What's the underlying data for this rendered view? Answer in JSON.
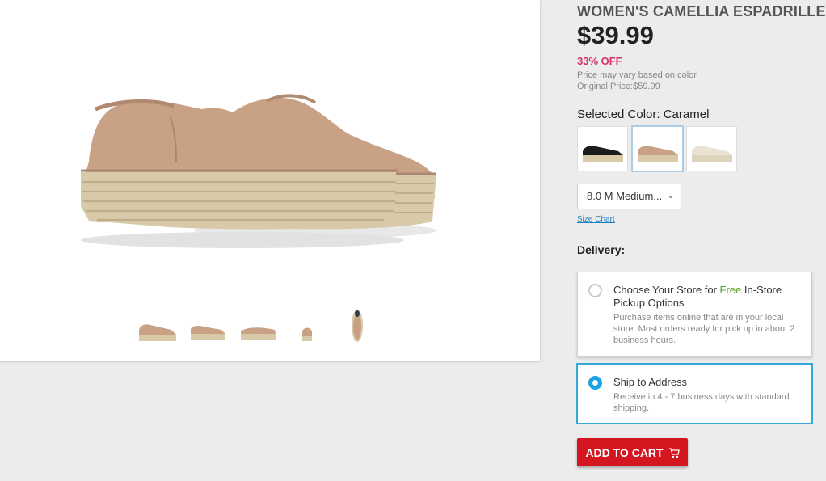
{
  "product": {
    "title": "WOMEN'S CAMELLIA ESPADRILLE",
    "price": "$39.99",
    "discount": "33% OFF",
    "price_note": "Price may vary based on color",
    "original_price": "Original Price:$59.99",
    "selected_color_label": "Selected Color: Caramel",
    "colors": [
      {
        "name": "Black",
        "swatch_hex": "#1c1c1c"
      },
      {
        "name": "Caramel",
        "swatch_hex": "#c9a286",
        "selected": true
      },
      {
        "name": "Cream",
        "swatch_hex": "#eae3d3"
      }
    ],
    "size_value": "8.0 M Medium...",
    "size_chart_label": "Size Chart"
  },
  "delivery": {
    "label": "Delivery:",
    "store_option": {
      "title_prefix": "Choose Your Store for ",
      "title_free": "Free",
      "title_suffix": " In-Store Pickup Options",
      "description": "Purchase items online that are in your local store. Most orders ready for pick up in about 2 business hours.",
      "selected": false
    },
    "ship_option": {
      "title": "Ship to Address",
      "description": "Receive in 4 - 7 business days with standard shipping.",
      "selected": true
    }
  },
  "cart": {
    "label": "ADD TO CART",
    "icon": "cart-icon"
  },
  "colors": {
    "accent_red": "#d3161f",
    "discount_pink": "#d6336c",
    "free_green": "#5a9e25",
    "selected_blue": "#1aa3e0",
    "shoe_suede": "#c9a286",
    "jute": "#d8c9a8"
  },
  "gallery": {
    "thumbnail_views": [
      "side",
      "side-alt",
      "profile",
      "back",
      "top"
    ]
  }
}
